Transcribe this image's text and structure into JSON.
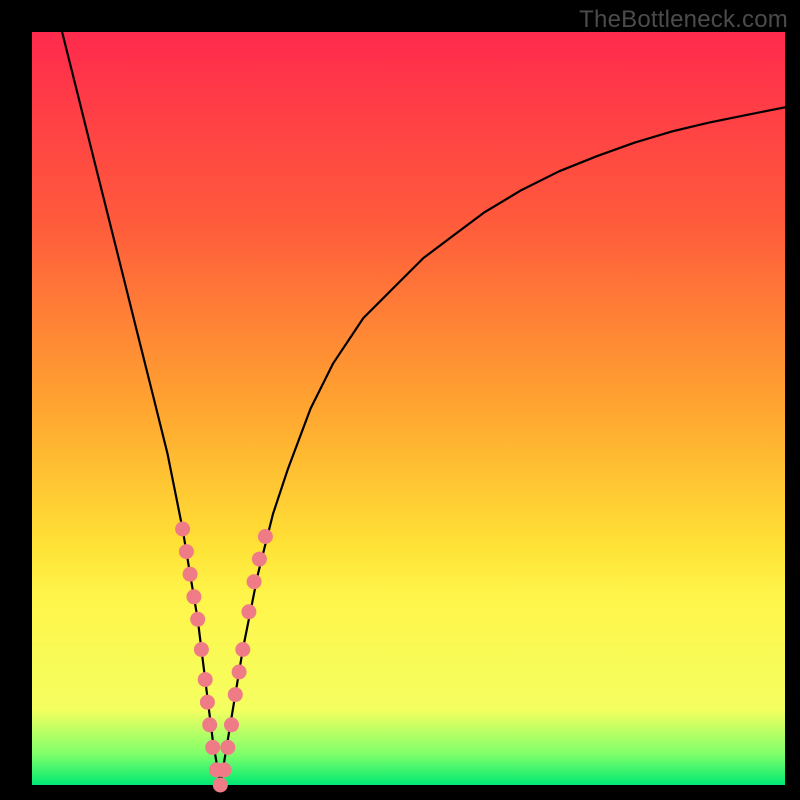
{
  "watermark": "TheBottleneck.com",
  "colors": {
    "gradient": {
      "c0": "#ff2a4d",
      "c1": "#ff5a3c",
      "c2": "#ffa530",
      "c3": "#ffe135",
      "c4": "#fff54a",
      "c5": "#f4ff60",
      "c6": "#7cff6a",
      "c7": "#00e873"
    },
    "dot": "#ef7b86"
  },
  "chart_data": {
    "type": "line",
    "title": "",
    "xlabel": "",
    "ylabel": "",
    "xlim": [
      0,
      100
    ],
    "ylim": [
      0,
      100
    ],
    "series": [
      {
        "name": "bottleneck-curve",
        "x": [
          4,
          6,
          8,
          10,
          12,
          14,
          16,
          18,
          20,
          21,
          22,
          23,
          24,
          25,
          26,
          28,
          30,
          32,
          34,
          37,
          40,
          44,
          48,
          52,
          56,
          60,
          65,
          70,
          75,
          80,
          85,
          90,
          95,
          100
        ],
        "y": [
          100,
          92,
          84,
          76,
          68,
          60,
          52,
          44,
          34,
          28,
          22,
          14,
          6,
          0,
          6,
          18,
          28,
          36,
          42,
          50,
          56,
          62,
          66,
          70,
          73,
          76,
          79,
          81.5,
          83.5,
          85.3,
          86.8,
          88,
          89,
          90
        ]
      }
    ],
    "datapoints": [
      {
        "x": 20.0,
        "y": 34
      },
      {
        "x": 20.5,
        "y": 31
      },
      {
        "x": 21.0,
        "y": 28
      },
      {
        "x": 21.5,
        "y": 25
      },
      {
        "x": 22.0,
        "y": 22
      },
      {
        "x": 22.5,
        "y": 18
      },
      {
        "x": 23.0,
        "y": 14
      },
      {
        "x": 23.3,
        "y": 11
      },
      {
        "x": 23.6,
        "y": 8
      },
      {
        "x": 24.0,
        "y": 5
      },
      {
        "x": 24.5,
        "y": 2
      },
      {
        "x": 25.0,
        "y": 0
      },
      {
        "x": 25.5,
        "y": 2
      },
      {
        "x": 26.0,
        "y": 5
      },
      {
        "x": 26.5,
        "y": 8
      },
      {
        "x": 27.0,
        "y": 12
      },
      {
        "x": 27.5,
        "y": 15
      },
      {
        "x": 28.0,
        "y": 18
      },
      {
        "x": 28.8,
        "y": 23
      },
      {
        "x": 29.5,
        "y": 27
      },
      {
        "x": 30.2,
        "y": 30
      },
      {
        "x": 31.0,
        "y": 33
      }
    ]
  }
}
